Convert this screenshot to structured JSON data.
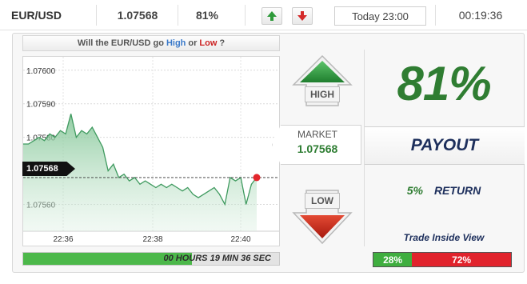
{
  "topbar": {
    "pair": "EUR/USD",
    "price": "1.07568",
    "percent": "81%",
    "expiry": "Today 23:00",
    "countdown": "00:19:36",
    "up_icon": "arrow-up-icon",
    "down_icon": "arrow-down-icon"
  },
  "question": {
    "prefix": "Will the EUR/USD go",
    "high": "High",
    "or": "or",
    "low": "Low",
    "suffix": "?"
  },
  "chart_data": {
    "type": "area",
    "y_ticks": [
      "1.07600",
      "1.07590",
      "1.07580",
      "1.07560"
    ],
    "x_ticks": [
      "22:36",
      "22:38",
      "22:40"
    ],
    "ylim": [
      1.07552,
      1.07604
    ],
    "current_value": 1.07568,
    "current_label": "1.07568",
    "grid": true,
    "color": "#3f9a5f",
    "values": [
      1.07578,
      1.07578,
      1.07579,
      1.0758,
      1.07579,
      1.07581,
      1.0758,
      1.07582,
      1.07581,
      1.07587,
      1.0758,
      1.07582,
      1.07581,
      1.07583,
      1.0758,
      1.07577,
      1.0757,
      1.07572,
      1.07568,
      1.07569,
      1.07567,
      1.07568,
      1.07566,
      1.07567,
      1.07566,
      1.07565,
      1.07566,
      1.07565,
      1.07566,
      1.07565,
      1.07564,
      1.07565,
      1.07563,
      1.07562,
      1.07563,
      1.07564,
      1.07565,
      1.07563,
      1.0756,
      1.07568,
      1.07567,
      1.07568,
      1.0756,
      1.07566,
      1.07568
    ]
  },
  "timer": {
    "text": "00 HOURS 19 MIN 36 SEC",
    "progress": 0.66
  },
  "buttons": {
    "high": "HIGH",
    "low": "LOW"
  },
  "market": {
    "label": "MARKET",
    "price": "1.07568"
  },
  "payout": {
    "percent": "81%",
    "label": "PAYOUT",
    "return_pct": "5%",
    "return_label": "RETURN",
    "inside_view": "Trade Inside View"
  },
  "sentiment": {
    "high": "28%",
    "low": "72%",
    "high_fraction": 0.28,
    "high_color": "#3fae3f",
    "low_color": "#e1232c"
  }
}
